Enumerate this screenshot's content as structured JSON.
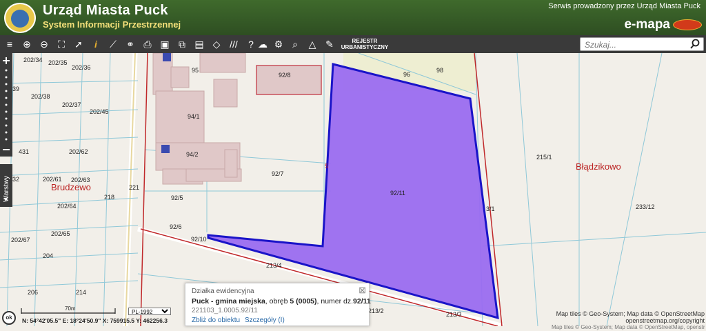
{
  "header": {
    "title": "Urząd Miasta Puck",
    "subtitle": "System Informacji Przestrzennej",
    "service_note": "Serwis prowadzony przez Urząd Miasta Puck",
    "brand": "e-mapa"
  },
  "toolbar": {
    "rejestr_line1": "REJESTR",
    "rejestr_line2": "URBANISTYCZNY",
    "icons": [
      "layers-icon",
      "zoom-in-icon",
      "zoom-out-icon",
      "zoom-extent-icon",
      "pointer-icon",
      "info-icon",
      "measure-distance-icon",
      "link-icon",
      "print-icon",
      "window-icon",
      "compare-icon",
      "layout-icon",
      "shape-icon",
      "parallel-lines-icon",
      "help-icon",
      "cloud-upload-icon",
      "settings-icon",
      "zoom-search-icon",
      "triangle-icon",
      "pin-comment-icon"
    ]
  },
  "search": {
    "placeholder": "Szukaj..."
  },
  "sidebar": {
    "layers_label": "Warstwy"
  },
  "map": {
    "parcel_labels": [
      {
        "text": "202/34"
      },
      {
        "text": "202/35"
      },
      {
        "text": "202/36"
      },
      {
        "text": "39"
      },
      {
        "text": "202/38"
      },
      {
        "text": "202/37"
      },
      {
        "text": "202/45"
      },
      {
        "text": "431"
      },
      {
        "text": "202/62"
      },
      {
        "text": "202/63"
      },
      {
        "text": "202/61"
      },
      {
        "text": "32"
      },
      {
        "text": "202/64"
      },
      {
        "text": "202/65"
      },
      {
        "text": "202/67"
      },
      {
        "text": "204"
      },
      {
        "text": "206"
      },
      {
        "text": "214"
      },
      {
        "text": "218"
      },
      {
        "text": "221"
      },
      {
        "text": "95"
      },
      {
        "text": "94/1"
      },
      {
        "text": "94/2"
      },
      {
        "text": "92/8"
      },
      {
        "text": "96"
      },
      {
        "text": "98"
      },
      {
        "text": "92/7"
      },
      {
        "text": "92/5"
      },
      {
        "text": "92/6"
      },
      {
        "text": "92/10"
      },
      {
        "text": "92/11"
      },
      {
        "text": "213/4"
      },
      {
        "text": "213/3"
      },
      {
        "text": "213/2"
      },
      {
        "text": "215/1"
      },
      {
        "text": "233/12"
      },
      {
        "text": "3/1"
      },
      {
        "text": "5"
      }
    ],
    "place_names": [
      "Brudzewo",
      "Błądzikowo"
    ]
  },
  "popup": {
    "title": "Działka ewidencyjna",
    "desc_prefix": "Puck - gmina miejska",
    "desc_mid": ", obręb ",
    "obreb": "5 (0005)",
    "desc_mid2": ", numer dz.",
    "parcel_no": "92/11",
    "identifier": "221103_1.0005.92/11",
    "link_zoom": "Zbliż do obiektu",
    "link_details": "Szczegóły (I)"
  },
  "status": {
    "scale": "70m",
    "crs": "PL-1992",
    "coords": "N: 54°42'05.5\"  E: 18°24'50.9\"   X: 759915.5   Y: 462256.3",
    "ok_label": "ok"
  },
  "attribution": {
    "line1": "Map tiles © Geo-System; Map data © OpenStreetMap",
    "line2": "openstreetmap.org/copyright",
    "line3": "Map tiles © Geo-System; Map data © OpenStreetMap, openstreetmap.org/copyright"
  },
  "colors": {
    "header_green": "#3a5a2a",
    "toolbar": "#3a3a3a",
    "selected_parcel_fill": "#9a6cf0",
    "selected_parcel_stroke": "#1a14c8",
    "parcel_line": "#8fc8d8",
    "building_fill": "#e0c8c8",
    "road_line": "#c0282a",
    "place_name": "#b22222"
  }
}
